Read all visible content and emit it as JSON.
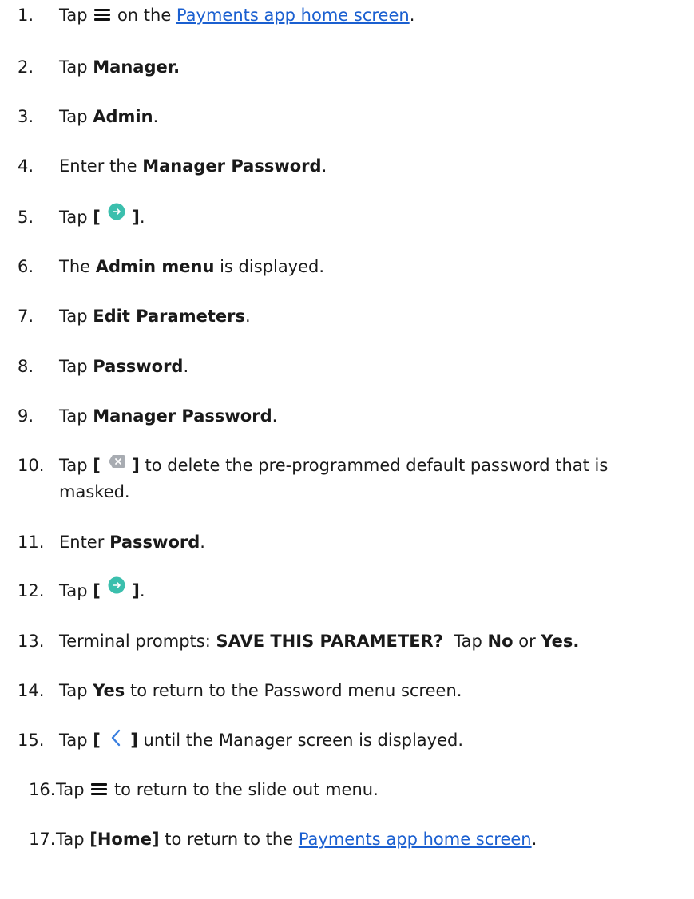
{
  "steps": [
    {
      "n": "1.",
      "pre": "Tap",
      "post": "on the",
      "link": "Payments app home screen",
      "end": "."
    },
    {
      "n": "2.",
      "pre": "Tap",
      "bold": "Manager."
    },
    {
      "n": "3.",
      "pre": "Tap",
      "bold": "Admin",
      "end": "."
    },
    {
      "n": "4.",
      "pre": "Enter the",
      "bold": "Manager Password",
      "end": "."
    },
    {
      "n": "5.",
      "pre": "Tap",
      "open": "[",
      "close": "]",
      "end": "."
    },
    {
      "n": "6.",
      "pre": "The",
      "bold": "Admin menu",
      "post": "is displayed."
    },
    {
      "n": "7.",
      "pre": "Tap",
      "bold": "Edit Parameters",
      "end": "."
    },
    {
      "n": "8.",
      "pre": "Tap",
      "bold": "Password",
      "end": "."
    },
    {
      "n": "9.",
      "pre": "Tap",
      "bold": "Manager Password",
      "end": "."
    },
    {
      "n": "10.",
      "pre": "Tap",
      "open": "[",
      "close": "]",
      "post": "to delete the pre-programmed default password that is",
      "line2": "masked."
    },
    {
      "n": "11.",
      "pre": "Enter",
      "bold": "Password",
      "end": "."
    },
    {
      "n": "12.",
      "pre": "Tap",
      "open": "[",
      "close": "]",
      "end": "."
    },
    {
      "n": "13.",
      "pre": "Terminal prompts:",
      "bold": "SAVE THIS PARAMETER?",
      "post": "Tap",
      "bold2": "No",
      "post2": "or",
      "bold3": "Yes."
    },
    {
      "n": "14.",
      "pre": "Tap",
      "bold": "Yes",
      "post": "to return to the Password menu screen."
    },
    {
      "n": "15.",
      "pre": "Tap",
      "open": "[",
      "close": "]",
      "post": "until the Manager screen is displayed."
    },
    {
      "n": "16.",
      "pre": "Tap",
      "post": "to return to the slide out menu."
    },
    {
      "n": "17.",
      "pre": "Tap",
      "bold": "[Home]",
      "post": "to return to the",
      "link": "Payments app home screen",
      "end": "."
    }
  ],
  "icons": {
    "menu": "hamburger-menu-icon",
    "enter": "go-arrow-circle-icon",
    "delete": "backspace-delete-icon",
    "back": "chevron-left-icon"
  },
  "colors": {
    "text": "#1a1a1a",
    "link": "#1a5fd0",
    "enter_icon": "#3bbfad"
  }
}
